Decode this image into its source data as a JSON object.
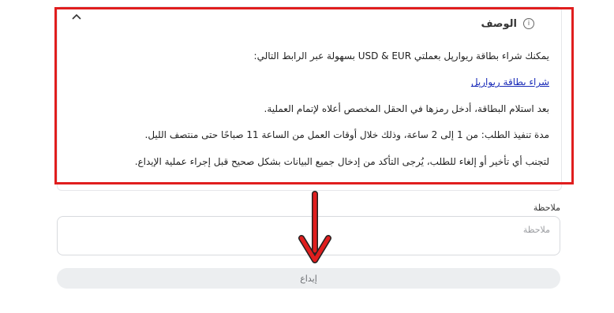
{
  "description": {
    "title": "الوصف",
    "lines": [
      "يمكنك شراء بطاقة ريوارپل بعملتي USD & EUR بسهولة عبر الرابط التالي:",
      "بعد استلام البطاقة، أدخل رمزها في الحقل المخصص أعلاه لإتمام العملية.",
      "مدة تنفيذ الطلب: من 1 إلى 2 ساعة، وذلك خلال أوقات العمل من الساعة 11 صباحًا حتى منتصف الليل.",
      "لتجنب أي تأخير أو إلغاء للطلب، يُرجى التأكد من إدخال جميع البيانات بشكل صحيح قبل إجراء عملية الإيداع."
    ],
    "link_text": "شراء بطاقة ريوارپل"
  },
  "note": {
    "label": "ملاحظة",
    "placeholder": "ملاحظة",
    "value": ""
  },
  "submit": {
    "label": "إيداع"
  },
  "icons": {
    "info": "info-icon",
    "collapse": "chevron-up-icon",
    "annotation": "red-arrow-down-icon"
  },
  "colors": {
    "highlight": "#e01e1e",
    "link": "#1a2bb8",
    "button_bg": "#eceef0"
  }
}
